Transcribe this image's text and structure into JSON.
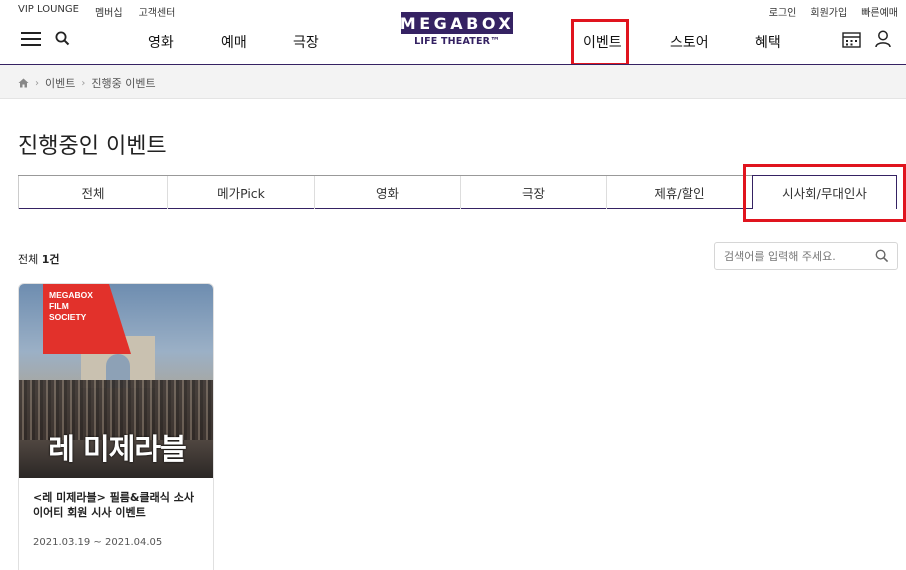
{
  "utility": {
    "left": [
      "VIP LOUNGE",
      "멤버십",
      "고객센터"
    ],
    "right": [
      "로그인",
      "회원가입",
      "빠른예매"
    ]
  },
  "nav": {
    "left": [
      "영화",
      "예매",
      "극장"
    ],
    "right": [
      "이벤트",
      "스토어",
      "혜택"
    ]
  },
  "logo": {
    "main": "MEGABOX",
    "sub": "LIFE THEATER™"
  },
  "breadcrumb": [
    "이벤트",
    "진행중 이벤트"
  ],
  "page_title": "진행중인 이벤트",
  "tabs": [
    "전체",
    "메가Pick",
    "영화",
    "극장",
    "제휴/할인",
    "시사회/무대인사"
  ],
  "active_tab": "시사회/무대인사",
  "count": {
    "label": "전체",
    "value": "1건"
  },
  "search": {
    "placeholder": "검색어를 입력해 주세요."
  },
  "events": [
    {
      "poster_badge": [
        "MEGABOX",
        "FILM",
        "SOCIETY"
      ],
      "poster_title": "레 미제라블",
      "title": "<레 미제라블> 필름&클래식 소사이어티 회원 시사 이벤트",
      "title_line1": "<레 미제라블> 필름&클래식 소사",
      "title_line2": "이어티 회원 시사 이벤트",
      "date": "2021.03.19 ~ 2021.04.05"
    }
  ],
  "colors": {
    "brand": "#352263",
    "highlight": "#e0141e",
    "poster_flag": "#e2312b"
  }
}
